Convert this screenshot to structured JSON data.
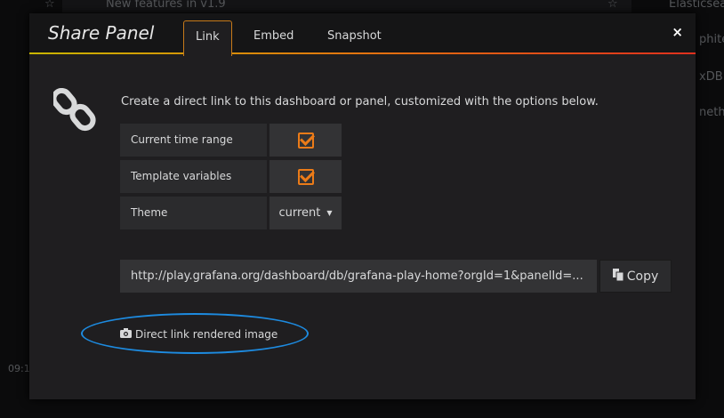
{
  "background": {
    "panel_title": "New features in v1.9",
    "right_items": [
      "Elasticsea",
      "phite",
      "xDB",
      "nethe"
    ],
    "time_label": "09:1"
  },
  "modal": {
    "title": "Share Panel",
    "tabs": [
      {
        "label": "Link",
        "active": true
      },
      {
        "label": "Embed",
        "active": false
      },
      {
        "label": "Snapshot",
        "active": false
      }
    ],
    "close_icon": "×",
    "description": "Create a direct link to this dashboard or panel, customized with the options below.",
    "options": [
      {
        "label": "Current time range",
        "checked": true
      },
      {
        "label": "Template variables",
        "checked": true
      },
      {
        "label": "Theme",
        "value": "current"
      }
    ],
    "url": "http://play.grafana.org/dashboard/db/grafana-play-home?orgId=1&panelId=...",
    "copy_label": "Copy",
    "direct_link_label": "Direct link rendered image",
    "accent": "#eb7b18",
    "annotation_color": "#1d8be0"
  }
}
